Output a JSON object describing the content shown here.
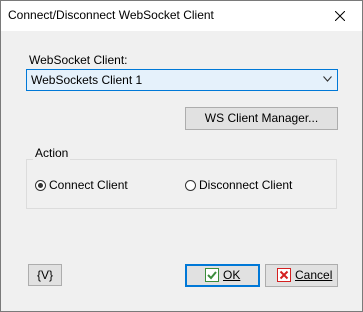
{
  "window": {
    "title": "Connect/Disconnect WebSocket Client",
    "close_glyph": "×"
  },
  "client": {
    "label": "WebSocket Client:",
    "selected": "WebSockets Client 1"
  },
  "manager_button": "WS Client Manager...",
  "action": {
    "legend": "Action",
    "options": [
      {
        "label": "Connect Client",
        "selected": true
      },
      {
        "label": "Disconnect Client",
        "selected": false
      }
    ]
  },
  "footer": {
    "variable_button": "{V}",
    "ok_label": "OK",
    "cancel_label": "Cancel"
  },
  "colors": {
    "accent": "#0078d7",
    "ok_icon": "#3c8c3c",
    "cancel_icon": "#d42020"
  },
  "icons": {
    "close": "close-icon",
    "dropdown": "chevron-down-icon",
    "ok": "checkmark-icon",
    "cancel": "x-mark-icon"
  }
}
